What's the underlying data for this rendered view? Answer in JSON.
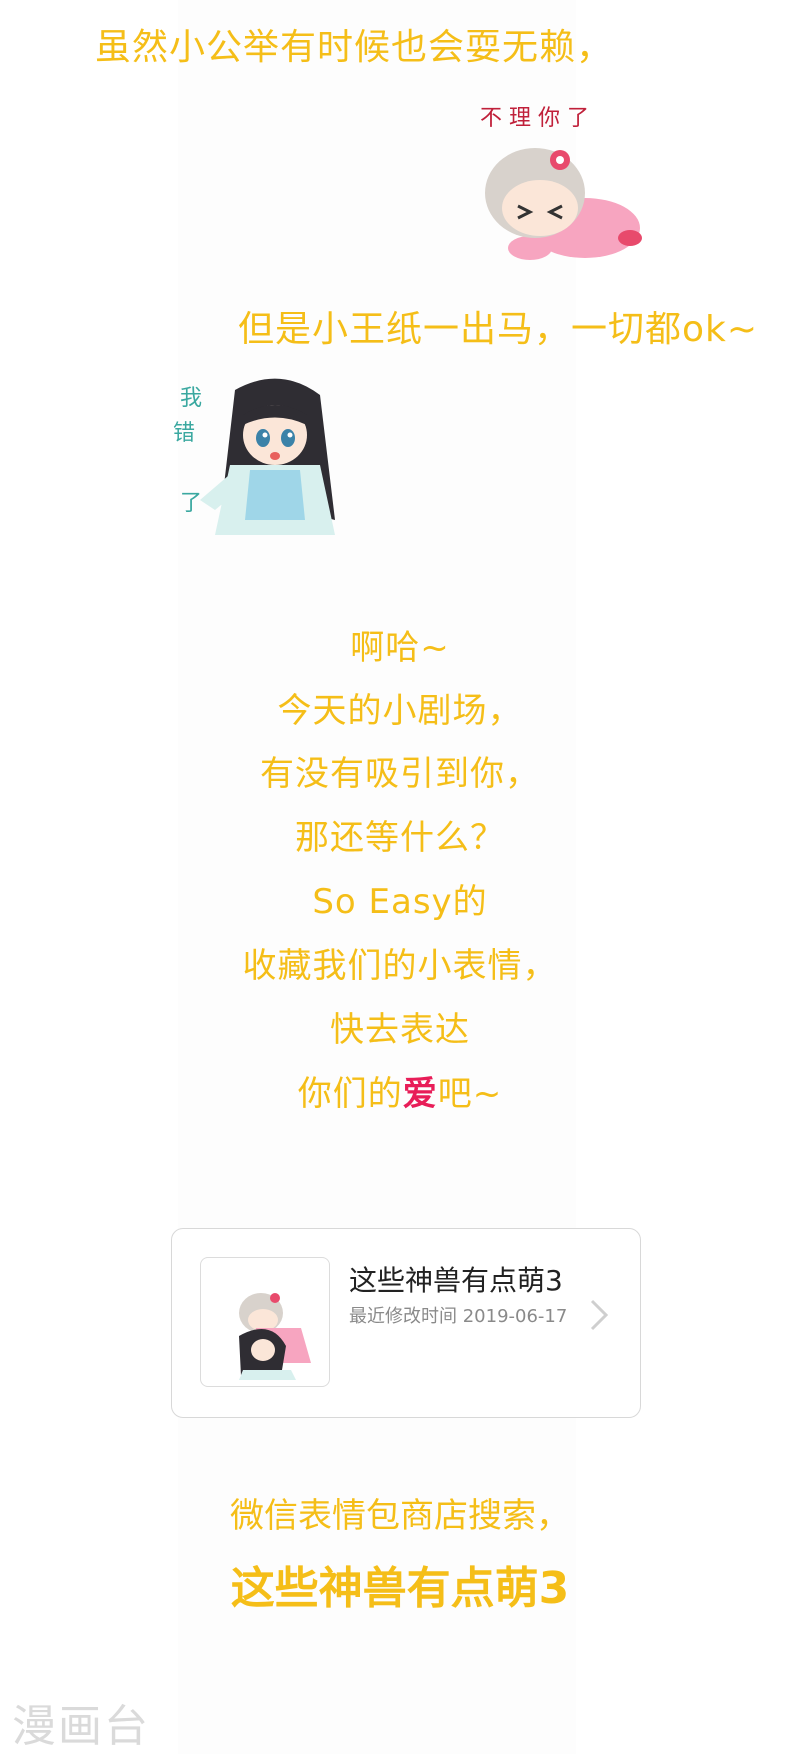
{
  "top_caption": "虽然小公举有时候也会耍无赖，",
  "sticker1": {
    "text": "不 理 你 了"
  },
  "mid_caption": "但是小王纸一出马，一切都ok~",
  "sticker2": {
    "text_line1": "我",
    "text_line2": "错",
    "text_line3": "了"
  },
  "message_lines": [
    "啊哈~",
    "今天的小剧场，",
    "有没有吸引到你，",
    "那还等什么？",
    "So Easy的",
    "收藏我们的小表情，",
    "快去表达"
  ],
  "last_line": {
    "prefix": "你们的",
    "highlight": "爱",
    "suffix": "吧~"
  },
  "card": {
    "title": "这些神兽有点萌3",
    "subtitle": "最近修改时间 2019-06-17"
  },
  "footer": {
    "line1": "微信表情包商店搜索，",
    "line2": "这些神兽有点萌3"
  },
  "watermark": "漫画台",
  "colors": {
    "caption": "#f5be18",
    "highlight": "#e81d58"
  }
}
